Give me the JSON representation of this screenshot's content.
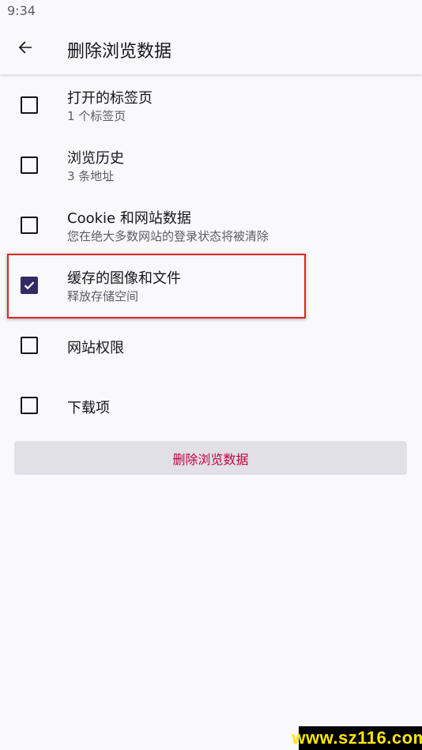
{
  "status_bar": {
    "time": "9:34"
  },
  "header": {
    "back_icon": "arrow-left-icon",
    "title": "删除浏览数据"
  },
  "options": [
    {
      "title": "打开的标签页",
      "subtitle": "1 个标签页",
      "checked": false
    },
    {
      "title": "浏览历史",
      "subtitle": "3 条地址",
      "checked": false
    },
    {
      "title": "Cookie 和网站数据",
      "subtitle": "您在绝大多数网站的登录状态将被清除",
      "checked": false
    },
    {
      "title": "缓存的图像和文件",
      "subtitle": "释放存储空间",
      "checked": true
    },
    {
      "title": "网站权限",
      "subtitle": "",
      "checked": false
    },
    {
      "title": "下载项",
      "subtitle": "",
      "checked": false
    }
  ],
  "delete_button": {
    "label": "删除浏览数据"
  },
  "colors": {
    "accent_checkbox": "#312a65",
    "delete_text": "#c50042",
    "highlight_border": "#e0261d"
  },
  "watermark": {
    "text": "www.sz116.com"
  }
}
